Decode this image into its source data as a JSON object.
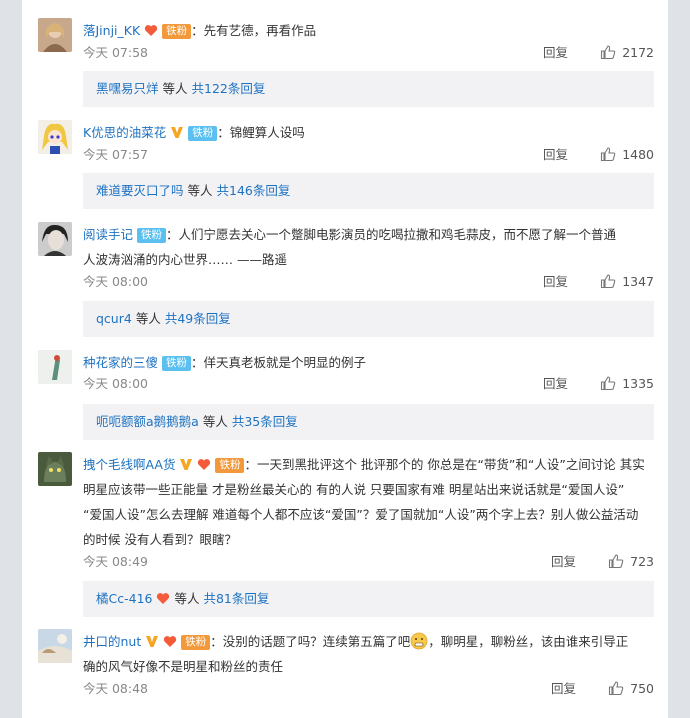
{
  "ui": {
    "reply_label": "回复",
    "others_label": "等人"
  },
  "comments": [
    {
      "user": "落Jinji_KK",
      "fan_badge": "铁粉",
      "text": "：先有艺德，再看作品",
      "time": "今天 07:58",
      "likes": "2172",
      "sub_user": "黑嘿易只烊",
      "sub_count": "共122条回复"
    },
    {
      "user": "K优思的油菜花",
      "fan_badge": "铁粉",
      "text": "：锦鲤算人设吗",
      "time": "今天 07:57",
      "likes": "1480",
      "sub_user": "难道要灭口了吗",
      "sub_count": "共146条回复"
    },
    {
      "user": "阅读手记",
      "fan_badge": "铁粉",
      "text": "：人们宁愿去关心一个蹩脚电影演员的吃喝拉撒和鸡毛蒜皮，而不愿了解一个普通",
      "text2": "人波涛汹涌的内心世界……  ——路遥",
      "time": "今天 08:00",
      "likes": "1347",
      "sub_user": "qcur4",
      "sub_count": "共49条回复"
    },
    {
      "user": "种花家的三傻",
      "fan_badge": "铁粉",
      "text": "：佯天真老板就是个明显的例子",
      "time": "今天 08:00",
      "likes": "1335",
      "sub_user": "呃呃额额a鹅鹅鹅a",
      "sub_count": "共35条回复"
    },
    {
      "user": "拽个毛线啊AA货",
      "fan_badge": "铁粉",
      "text": "：一天到黑批评这个 批评那个的 你总是在“带货”和“人设”之间讨论 其实",
      "text2": "明星应该带一些正能量 才是粉丝最关心的 有的人说 只要国家有难 明星站出来说话就是“爱国人设”",
      "text3": "“爱国人设”怎么去理解 难道每个人都不应该“爱国”？爱了国就加“人设”两个字上去？别人做公益活动",
      "text4": "的时候 没有人看到？眼瞎？",
      "time": "今天 08:49",
      "likes": "723",
      "sub_user": "橘Cc-416",
      "sub_count": "共81条回复"
    },
    {
      "user": "井口的nut",
      "fan_badge": "铁粉",
      "text": "：没别的话题了吗？连续第五篇了吧",
      "text_after_emoji": "，聊明星，聊粉丝，该由谁来引导正",
      "text2": "确的风气好像不是明星和粉丝的责任",
      "time": "今天 08:48",
      "likes": "750"
    }
  ]
}
